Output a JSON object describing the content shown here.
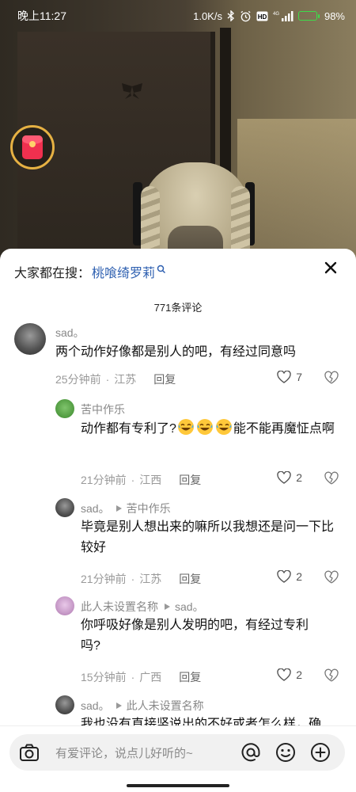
{
  "status_bar": {
    "time": "晚上11:27",
    "net_speed": "1.0K/s",
    "network_label": "4G",
    "battery": "98%",
    "battery_level": 0.98
  },
  "sheet": {
    "search_prefix": "大家都在搜：",
    "search_term": "桃喰绮罗莉",
    "comment_count": "771条评论"
  },
  "comments": [
    {
      "user": "sad。",
      "reply_to": "",
      "text": "两个动作好像都是别人的吧，有经过同意吗",
      "time": "25分钟前",
      "location": "江苏",
      "reply_label": "回复",
      "likes": "7"
    },
    {
      "user": "苦中作乐",
      "reply_to": "",
      "text_before": "动作都有专利了?",
      "text_after": "能不能再魔怔点啊",
      "emoji_count": 3,
      "time": "21分钟前",
      "location": "江西",
      "reply_label": "回复",
      "likes": "2"
    },
    {
      "user": "sad。",
      "reply_to": "苦中作乐",
      "text": "毕竟是别人想出来的嘛所以我想还是问一下比较好",
      "time": "21分钟前",
      "location": "江苏",
      "reply_label": "回复",
      "likes": "2"
    },
    {
      "user": "此人未设置名称",
      "reply_to": "sad。",
      "text": "你呼吸好像是别人发明的吧，有经过专利吗?",
      "time": "15分钟前",
      "location": "广西",
      "reply_label": "回复",
      "likes": "2"
    },
    {
      "user": "sad。",
      "reply_to": "此人未设置名称",
      "text": "我也没有直接竖说出的不好或者怎么样，确"
    }
  ],
  "input": {
    "placeholder": "有爱评论，说点儿好听的~"
  },
  "icons": {
    "camera": "camera-icon",
    "mention": "at-icon",
    "emoji": "emoji-icon",
    "add": "plus-circle-icon",
    "close": "close-icon",
    "like": "heart-outline-icon",
    "dislike": "broken-heart-icon"
  }
}
